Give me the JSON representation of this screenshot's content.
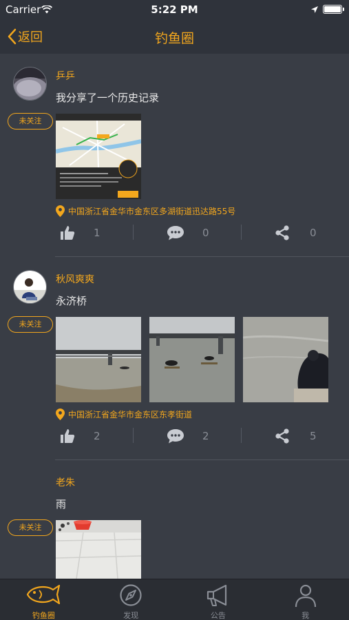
{
  "status_bar": {
    "carrier": "Carrier",
    "time": "5:22 PM"
  },
  "nav": {
    "back_label": "返回",
    "title": "钓鱼圈"
  },
  "colors": {
    "accent": "#f3a71d",
    "background": "#393d45",
    "bar": "#2f333b"
  },
  "posts": [
    {
      "username": "乒乒",
      "follow_label": "未关注",
      "content": "我分享了一个历史记录",
      "location": "中国浙江省金华市金东区多湖街道迅达路55号",
      "likes": "1",
      "comments": "0",
      "shares": "0"
    },
    {
      "username": "秋风爽爽",
      "follow_label": "未关注",
      "content": "永济桥",
      "location": "中国浙江省金华市金东区东孝街道",
      "likes": "2",
      "comments": "2",
      "shares": "5"
    },
    {
      "username": "老朱",
      "follow_label": "未关注",
      "content": "雨"
    }
  ],
  "tabs": [
    {
      "label": "钓鱼圈",
      "icon": "fish-icon",
      "active": true
    },
    {
      "label": "发现",
      "icon": "compass-icon",
      "active": false
    },
    {
      "label": "公告",
      "icon": "megaphone-icon",
      "active": false
    },
    {
      "label": "我",
      "icon": "person-icon",
      "active": false
    }
  ]
}
